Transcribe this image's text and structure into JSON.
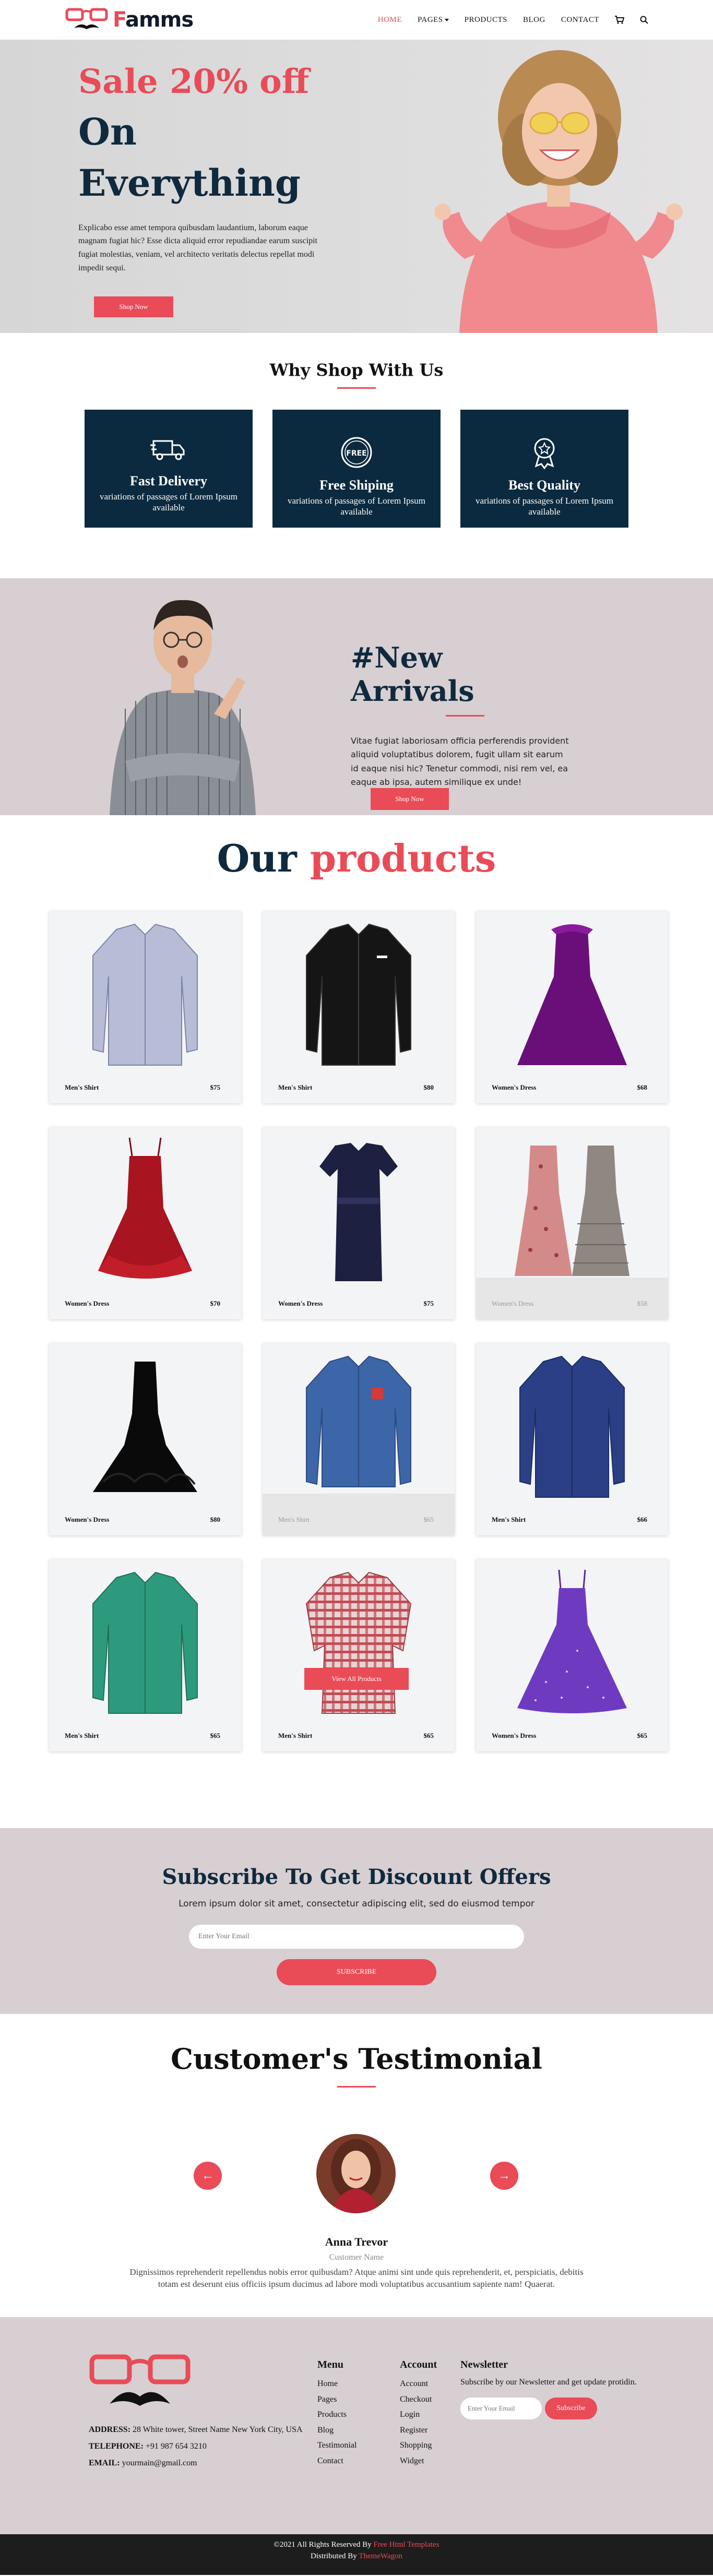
{
  "brand": {
    "name": "Famms",
    "accent": "#e94b57",
    "dark": "#0b2a3f"
  },
  "nav": {
    "items": [
      "HOME",
      "PAGES",
      "PRODUCTS",
      "BLOG",
      "CONTACT"
    ],
    "icons": [
      "cart-icon",
      "search-icon"
    ]
  },
  "hero": {
    "sale": "Sale 20% off",
    "line1": "On",
    "line2": "Everything",
    "description": "Explicabo esse amet tempora quibusdam laudantium, laborum eaque magnam fugiat hic? Esse dicta aliquid error repudiandae earum suscipit fugiat molestias, veniam, vel architecto veritatis delectus repellat modi impedit sequi.",
    "button": "Shop Now"
  },
  "why": {
    "title": "Why Shop With Us",
    "cards": [
      {
        "icon": "truck-icon",
        "title": "Fast Delivery",
        "text": "variations of passages of Lorem Ipsum available"
      },
      {
        "icon": "free-badge-icon",
        "title": "Free Shiping",
        "text": "variations of passages of Lorem Ipsum available"
      },
      {
        "icon": "award-icon",
        "title": "Best Quality",
        "text": "variations of passages of Lorem Ipsum available"
      }
    ]
  },
  "arrivals": {
    "title": "#New Arrivals",
    "description": "Vitae fugiat laboriosam officia perferendis provident aliquid voluptatibus dolorem, fugit ullam sit earum id eaque nisi hic? Tenetur commodi, nisi rem vel, ea eaque ab ipsa, autem similique ex unde!",
    "button": "Shop Now"
  },
  "products": {
    "title_a": "Our",
    "title_b": "products",
    "items": [
      {
        "name": "Men's Shirt",
        "price": "$75"
      },
      {
        "name": "Men's Shirt",
        "price": "$80"
      },
      {
        "name": "Women's Dress",
        "price": "$68"
      },
      {
        "name": "Women's Dress",
        "price": "$70"
      },
      {
        "name": "Women's Dress",
        "price": "$75"
      },
      {
        "name": "Women's Dress",
        "price": "$58"
      },
      {
        "name": "Women's Dress",
        "price": "$80"
      },
      {
        "name": "Men's Shirt",
        "price": "$65"
      },
      {
        "name": "Men's Shirt",
        "price": "$66"
      },
      {
        "name": "Men's Shirt",
        "price": "$65"
      },
      {
        "name": "Men's Shirt",
        "price": "$65"
      },
      {
        "name": "Women's Dress",
        "price": "$65"
      }
    ],
    "view_all": "View All Products"
  },
  "subscribe": {
    "title": "Subscribe To Get Discount Offers",
    "description": "Lorem ipsum dolor sit amet, consectetur adipiscing elit, sed do eiusmod tempor",
    "placeholder": "Enter Your Email",
    "button": "SUBSCRIBE"
  },
  "testimonial": {
    "title": "Customer's Testimonial",
    "name": "Anna Trevor",
    "role": "Customer Name",
    "quote": "Dignissimos reprehenderit repellendus nobis error quibusdam? Atque animi sint unde quis reprehenderit, et, perspiciatis, debitis totam est deserunt eius officiis ipsum ducimus ad labore modi voluptatibus accusantium sapiente nam! Quaerat."
  },
  "footer": {
    "address_label": "ADDRESS:",
    "address": "28 White tower, Street Name New York City, USA",
    "phone_label": "TELEPHONE:",
    "phone": "+91 987 654 3210",
    "email_label": "EMAIL:",
    "email": "yourmain@gmail.com",
    "menu_title": "Menu",
    "menu": [
      "Home",
      "Pages",
      "Products",
      "Blog",
      "Testimonial",
      "Contact"
    ],
    "account_title": "Account",
    "account": [
      "Account",
      "Checkout",
      "Login",
      "Register",
      "Shopping",
      "Widget"
    ],
    "newsletter_title": "Newsletter",
    "newsletter_text": "Subscribe by our Newsletter and get update protidin.",
    "newsletter_placeholder": "Enter Your Email",
    "newsletter_button": "Subscribe"
  },
  "copyright": {
    "a": "©2021 All Rights Reserved By",
    "b": "Free Html Templates",
    "c": "Distributed By",
    "d": "ThemeWagon"
  }
}
